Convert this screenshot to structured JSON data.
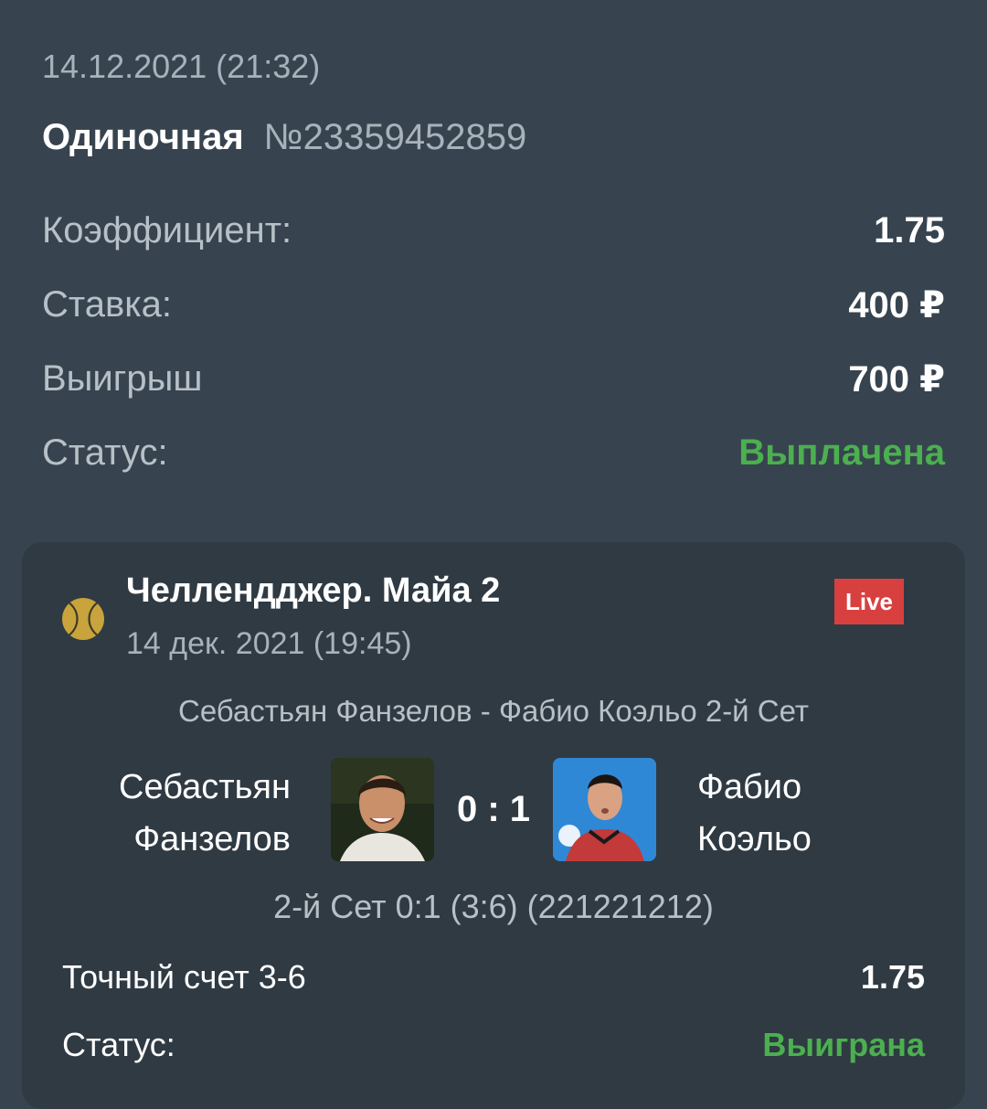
{
  "bet": {
    "datetime": "14.12.2021 (21:32)",
    "type": "Одиночная",
    "number": "№23359452859",
    "rows": [
      {
        "label": "Коэффициент:",
        "value": "1.75"
      },
      {
        "label": "Ставка:",
        "value": "400 ₽"
      },
      {
        "label": "Выигрыш",
        "value": "700 ₽"
      },
      {
        "label": "Статус:",
        "value": "Выплачена"
      }
    ]
  },
  "event": {
    "tournament": "Челлендджер. Майа 2",
    "date": "14 дек. 2021 (19:45)",
    "live_badge": "Live",
    "match_title": "Себастьян Фанзелов - Фабио Коэльо 2-й Сет",
    "player1": {
      "first": "Себастьян",
      "last": "Фанзелов"
    },
    "player2": {
      "first": "Фабио",
      "last": "Коэльо"
    },
    "score": "0 : 1",
    "set_info": "2-й Сет 0:1 (3:6) (221221212)",
    "outcome": {
      "label": "Точный счет 3-6",
      "value": "1.75"
    },
    "outcome_status": {
      "label": "Статус:",
      "value": "Выиграна"
    },
    "icon": "tennis-ball-icon"
  },
  "colors": {
    "background": "#37444f",
    "card": "#2f3a43",
    "success": "#4caf50",
    "live": "#d84040"
  }
}
